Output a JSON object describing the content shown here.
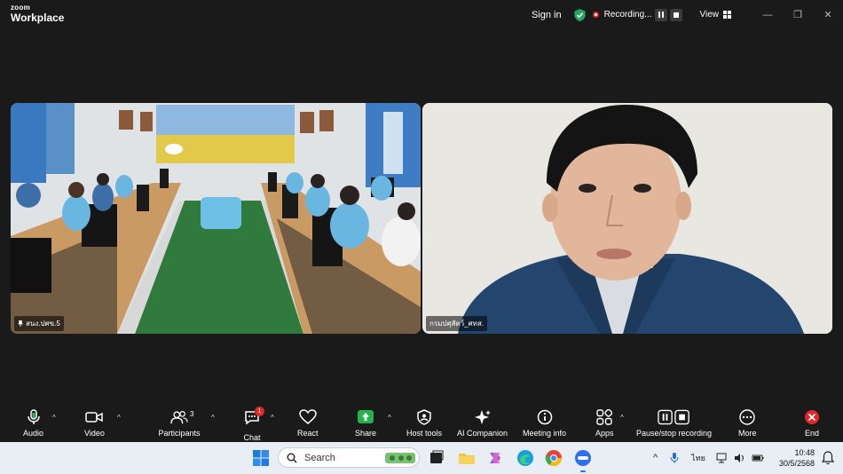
{
  "app": {
    "logo_top": "zoom",
    "logo_bottom": "Workplace"
  },
  "titlebar": {
    "sign_in": "Sign in",
    "recording": "Recording...",
    "view": "View",
    "minimize": "—",
    "restore": "❐",
    "close": "✕"
  },
  "videos": {
    "left_label": "สนง.ปศข.5",
    "right_label": "กรมปศุสัตว์_ศทส."
  },
  "toolbar": {
    "audio": "Audio",
    "video": "Video",
    "participants": "Participants",
    "participants_count": "3",
    "chat": "Chat",
    "chat_badge": "1",
    "react": "React",
    "share": "Share",
    "host_tools": "Host tools",
    "ai_companion": "AI Companion",
    "meeting_info": "Meeting info",
    "apps": "Apps",
    "pause_stop": "Pause/stop recording",
    "more": "More",
    "end": "End"
  },
  "taskbar": {
    "search_placeholder": "Search",
    "language": "ไทย",
    "time": "10:48",
    "date": "30/5/2568"
  },
  "colors": {
    "accent_green": "#22a860",
    "record_red": "#e02828",
    "share_green": "#23b34d"
  }
}
